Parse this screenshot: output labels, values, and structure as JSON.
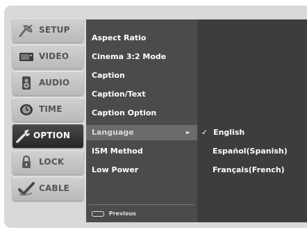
{
  "sidebar": {
    "tabs": [
      {
        "label": "SETUP",
        "icon": "satellite-dish-icon"
      },
      {
        "label": "VIDEO",
        "icon": "tv-screen-icon"
      },
      {
        "label": "AUDIO",
        "icon": "speaker-icon"
      },
      {
        "label": "TIME",
        "icon": "clock-icon"
      },
      {
        "label": "OPTION",
        "icon": "wrench-icon",
        "active": true
      },
      {
        "label": "LOCK",
        "icon": "padlock-icon"
      },
      {
        "label": "CABLE",
        "icon": "cable-check-icon"
      }
    ]
  },
  "menu": {
    "items": [
      "Aspect Ratio",
      "Cinema 3:2 Mode",
      "Caption",
      "Caption/Text",
      "Caption Option",
      "Language",
      "ISM Method",
      "Low Power"
    ],
    "selected": "Language",
    "arrow": "►",
    "footer": {
      "key_icon": "menu-key-icon",
      "label": "Previous"
    }
  },
  "submenu": {
    "check": "✓",
    "items": [
      "English",
      "Español(Spanish)",
      "Français(French)"
    ],
    "checked": "English"
  },
  "colors": {
    "frame": "#d9d9d9",
    "menu_bg": "#4b4b4b",
    "submenu_bg": "#3d3d3d",
    "highlight": "#6b6b6b",
    "tab_active": "#2e2e2e"
  }
}
